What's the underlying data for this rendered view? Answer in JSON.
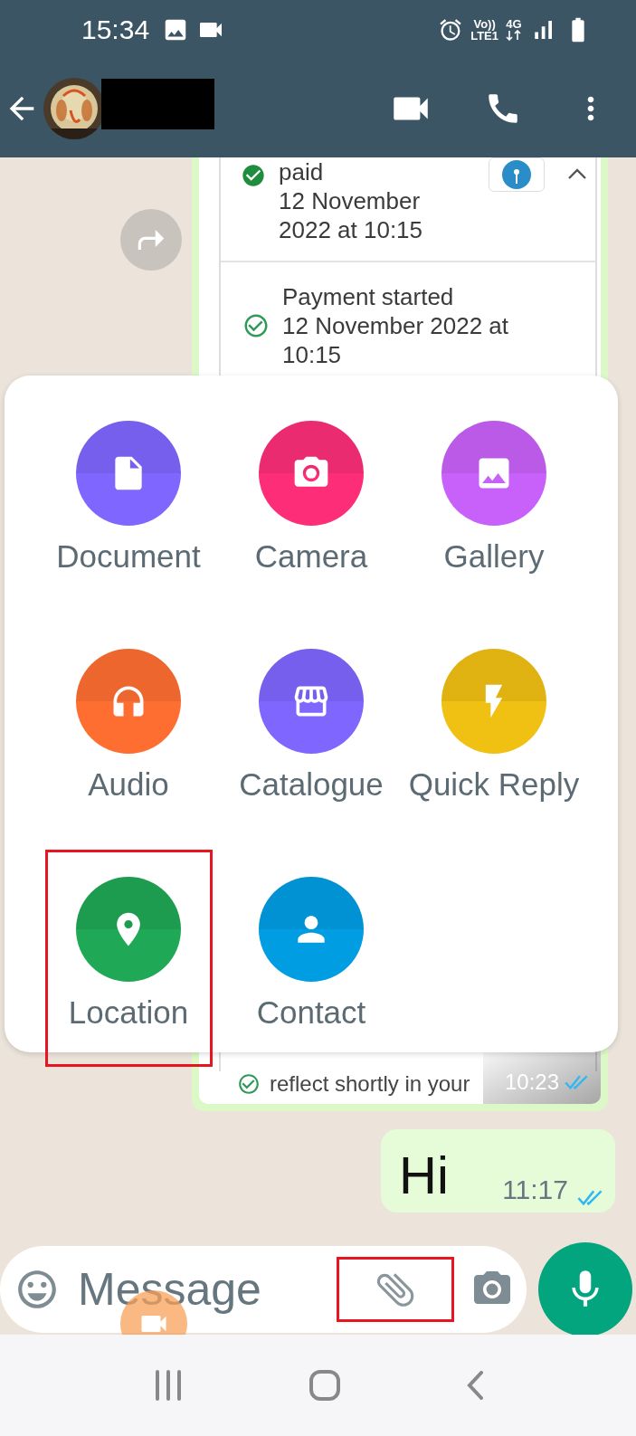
{
  "status_bar": {
    "time": "15:34",
    "volte": "Vo))",
    "lte": "LTE1",
    "network": "4G"
  },
  "chat": {
    "image_message": {
      "rows": [
        {
          "title": "paid",
          "date": "12 November 2022 at 10:15",
          "complete": true,
          "narrow": true
        },
        {
          "title": "Payment started",
          "date": "12 November 2022 at 10:15",
          "complete": false,
          "narrow": false
        }
      ],
      "footer": "reflect shortly in your",
      "time": "10:23",
      "read": true
    },
    "text_message": {
      "text": "Hi",
      "time": "11:17",
      "read": true
    }
  },
  "attach_menu": {
    "items": [
      {
        "kind": "document",
        "label": "Document",
        "color": "#7f66ff",
        "highlighted": false
      },
      {
        "kind": "camera",
        "label": "Camera",
        "color": "#fd2e77",
        "highlighted": false
      },
      {
        "kind": "gallery",
        "label": "Gallery",
        "color": "#c861f9",
        "highlighted": false
      },
      {
        "kind": "audio",
        "label": "Audio",
        "color": "#ff6e31",
        "highlighted": false
      },
      {
        "kind": "catalogue",
        "label": "Catalogue",
        "color": "#7f66ff",
        "highlighted": false
      },
      {
        "kind": "quick_reply",
        "label": "Quick Reply",
        "color": "#f0c013",
        "highlighted": false
      },
      {
        "kind": "location",
        "label": "Location",
        "color": "#1fa855",
        "highlighted": true
      },
      {
        "kind": "contact",
        "label": "Contact",
        "color": "#009de2",
        "highlighted": false
      }
    ]
  },
  "composer": {
    "placeholder": "Message",
    "attach_highlighted": true
  }
}
